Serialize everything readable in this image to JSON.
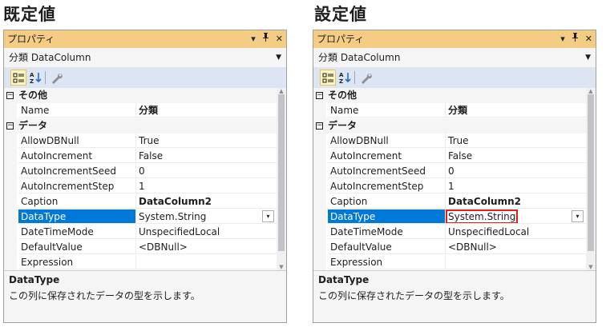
{
  "left": {
    "heading": "既定値",
    "title": "プロパティ",
    "object": "分類  DataColumn",
    "categories": [
      {
        "label": "その他",
        "rows": [
          {
            "name": "Name",
            "value": "分類",
            "bold": true
          }
        ]
      },
      {
        "label": "データ",
        "rows": [
          {
            "name": "AllowDBNull",
            "value": "True"
          },
          {
            "name": "AutoIncrement",
            "value": "False"
          },
          {
            "name": "AutoIncrementSeed",
            "value": "0"
          },
          {
            "name": "AutoIncrementStep",
            "value": "1"
          },
          {
            "name": "Caption",
            "value": "DataColumn2",
            "bold": true
          },
          {
            "name": "DataType",
            "value": "System.String",
            "selected": true
          },
          {
            "name": "DateTimeMode",
            "value": "UnspecifiedLocal"
          },
          {
            "name": "DefaultValue",
            "value": "<DBNull>"
          },
          {
            "name": "Expression",
            "value": ""
          }
        ]
      }
    ],
    "desc_title": "DataType",
    "desc_text": "この列に保存されたデータの型を示します。"
  },
  "right": {
    "heading": "設定値",
    "title": "プロパティ",
    "object": "分類  DataColumn",
    "categories": [
      {
        "label": "その他",
        "rows": [
          {
            "name": "Name",
            "value": "分類",
            "bold": true
          }
        ]
      },
      {
        "label": "データ",
        "rows": [
          {
            "name": "AllowDBNull",
            "value": "True"
          },
          {
            "name": "AutoIncrement",
            "value": "False"
          },
          {
            "name": "AutoIncrementSeed",
            "value": "0"
          },
          {
            "name": "AutoIncrementStep",
            "value": "1"
          },
          {
            "name": "Caption",
            "value": "DataColumn2",
            "bold": true
          },
          {
            "name": "DataType",
            "value": "System.String",
            "selected": true,
            "highlighted": true
          },
          {
            "name": "DateTimeMode",
            "value": "UnspecifiedLocal"
          },
          {
            "name": "DefaultValue",
            "value": "<DBNull>"
          },
          {
            "name": "Expression",
            "value": ""
          }
        ]
      }
    ],
    "desc_title": "DataType",
    "desc_text": "この列に保存されたデータの型を示します。"
  },
  "icons": {
    "pin": "pin-icon",
    "close": "close-icon",
    "menu": "menu-dropdown-icon",
    "categorized": "categorized-icon",
    "alphabetical": "alphabetical-icon",
    "property_pages": "wrench-icon"
  },
  "colors": {
    "titlebar": "#f5cc84",
    "selection": "#0078d7",
    "highlight_box": "#e0201c"
  }
}
